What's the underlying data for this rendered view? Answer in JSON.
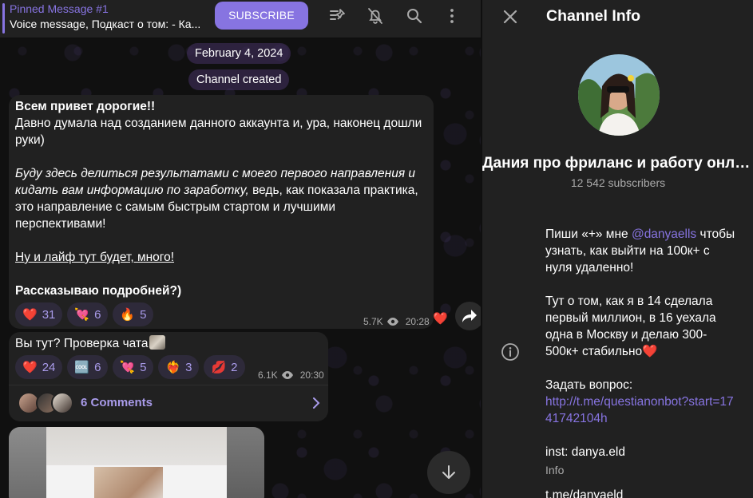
{
  "header": {
    "pinned_title": "Pinned Message #1",
    "pinned_text": "Voice message, Подкаст о том: - Ка...",
    "subscribe_label": "SUBSCRIBE"
  },
  "chat": {
    "date_label": "February 4, 2024",
    "service_message": "Channel created",
    "message1": {
      "line_bold": "Всем привет дорогие!!",
      "line2": "Давно думала над созданием данного аккаунта и, ура, наконец дошли руки)",
      "italic_part": "Буду здесь делиться результатами с моего первого направления и кидать вам информацию по заработку,",
      "plain_part": " ведь, как показала практика, это направление с самым быстрым стартом и лучшими перспективами!",
      "underlined": "Ну и лайф тут будет, много!",
      "closing_bold": "Рассказываю подробней?)",
      "reactions": [
        {
          "emoji": "❤️",
          "count": "31"
        },
        {
          "emoji": "💘",
          "count": "6"
        },
        {
          "emoji": "🔥",
          "count": "5"
        }
      ],
      "views": "5.7K",
      "time": "20:28",
      "side_reaction": "❤️"
    },
    "message2": {
      "text": "Вы тут? Проверка чата",
      "reactions": [
        {
          "emoji": "❤️",
          "count": "24"
        },
        {
          "emoji": "🆒",
          "count": "6"
        },
        {
          "emoji": "💘",
          "count": "5"
        },
        {
          "emoji": "❤️‍🔥",
          "count": "3"
        },
        {
          "emoji": "💋",
          "count": "2"
        }
      ],
      "views": "6.1K",
      "time": "20:30",
      "comments_label": "6 Comments"
    }
  },
  "info_panel": {
    "title": "Channel Info",
    "channel_name": "Дания про фриланс и работу онлайн",
    "subscribers": "12 542 subscribers",
    "description": {
      "p1_before": "Пиши «+» мне ",
      "p1_mention": "@danyaells",
      "p1_after": " чтобы узнать, как выйти на 100к+ с нуля удаленно!",
      "p2": "Тут о том, как я в 14 сделала первый миллион, в 16 уехала одна в Москву и делаю 300-500к+ стабильно❤️",
      "p3_label": "Задать вопрос:",
      "p3_link": "http://t.me/questianonbot?start=1741742104h",
      "p4": "inst: danya.eld"
    },
    "info_label": "Info",
    "link_line": "t.me/danyaeld"
  },
  "colors": {
    "accent": "#8774e1",
    "panel_bg": "#212121",
    "chat_bg": "#101010",
    "reaction_bg": "#2e2a3a"
  }
}
